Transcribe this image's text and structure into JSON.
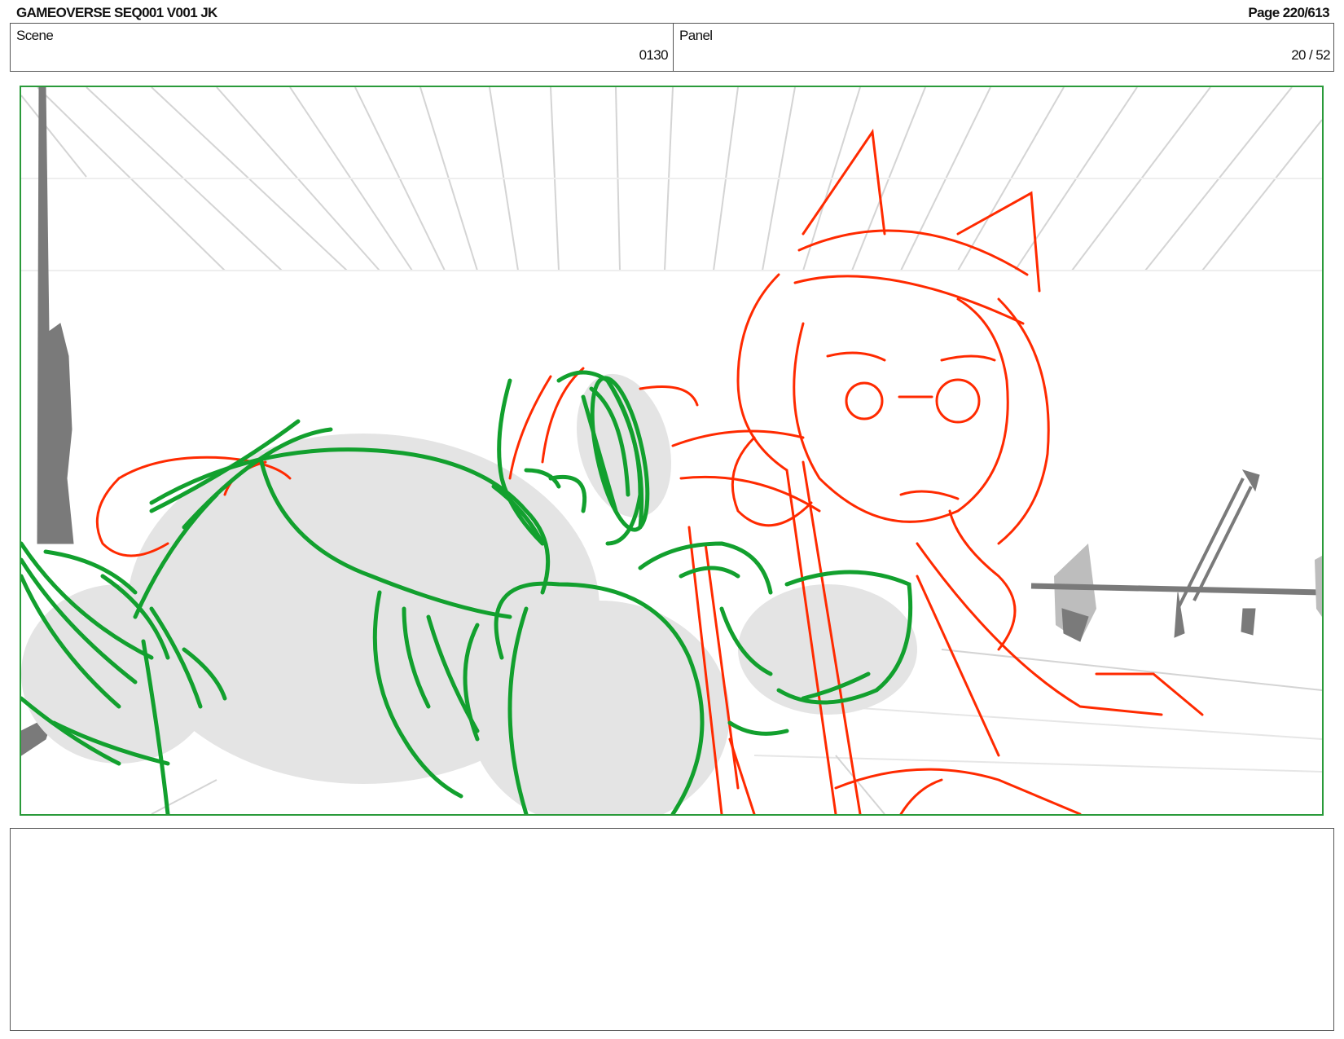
{
  "header": {
    "title": "GAMEOVERSE SEQ001 V001 JK",
    "page": "Page 220/613"
  },
  "info": {
    "scene_label": "Scene",
    "scene_value": "0130",
    "panel_label": "Panel",
    "panel_value": "20 / 52"
  },
  "panel_art": {
    "subject": "storyboard-sketch",
    "colors": {
      "frame": "#2a9a3a",
      "green_character": "#12a02e",
      "red_character": "#ff2a00",
      "fill_gray": "#e4e4e4",
      "background_lines": "#d4d4d4",
      "props_gray": "#7a7a7a"
    }
  },
  "notes": {
    "text": ""
  }
}
